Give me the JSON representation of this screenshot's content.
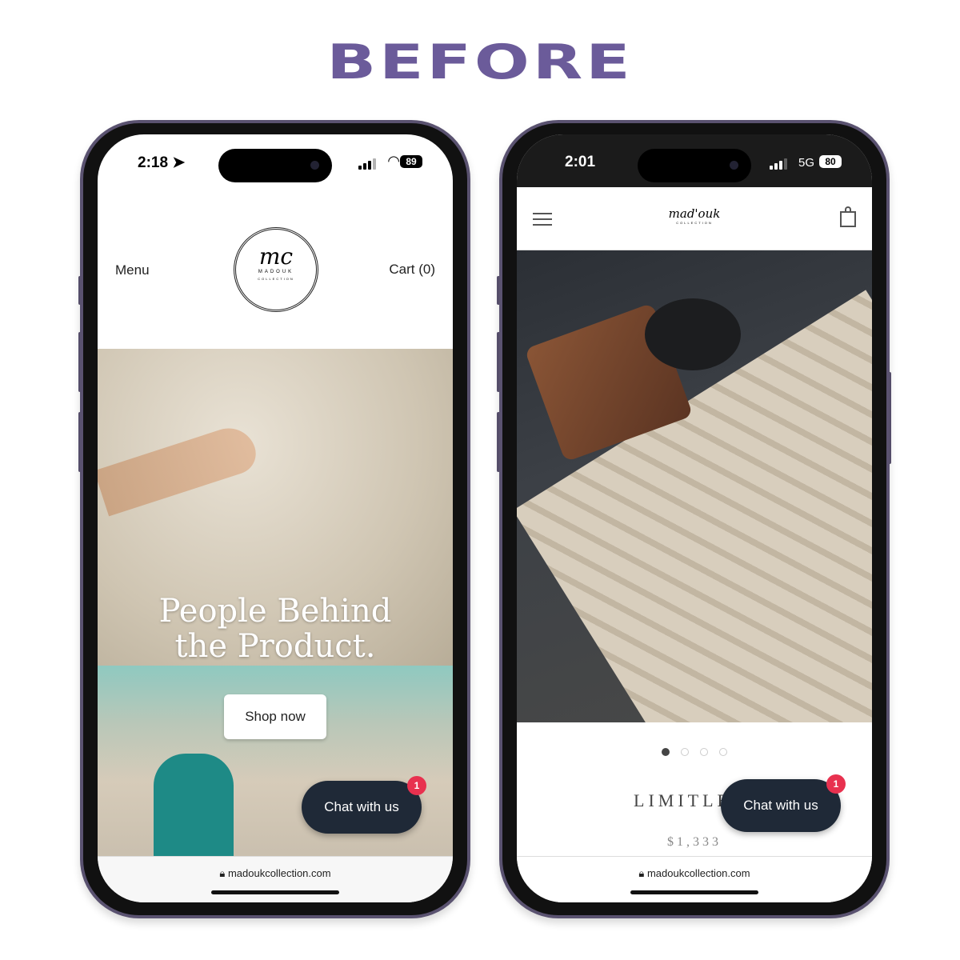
{
  "heading": "BEFORE",
  "colors": {
    "heading": "#6b5b9a",
    "chat_button": "#1f2937",
    "badge": "#e8314f"
  },
  "left_phone": {
    "status": {
      "time": "2:18",
      "battery": "89",
      "icons": [
        "location-arrow-icon",
        "signal-icon",
        "wifi-icon",
        "battery-icon"
      ]
    },
    "nav": {
      "menu": "Menu",
      "cart": "Cart (0)",
      "logo_text": "MADOUK",
      "logo_sub": "COLLECTION",
      "logo_mark": "mc"
    },
    "hero": {
      "headline_line1": "People Behind",
      "headline_line2": "the Product.",
      "cta": "Shop now"
    },
    "chat": {
      "label": "Chat with us",
      "badge": "1"
    },
    "url": "madoukcollection.com"
  },
  "right_phone": {
    "status": {
      "time": "2:01",
      "network": "5G",
      "battery": "80"
    },
    "nav": {
      "logo_text": "mad'ouk",
      "logo_sub": "COLLECTION",
      "icons": [
        "hamburger-menu-icon",
        "shopping-bag-icon"
      ]
    },
    "carousel": {
      "slides": 4,
      "active": 1
    },
    "product": {
      "title": "LIMITLE",
      "price": "$1,333"
    },
    "chat": {
      "label": "Chat with us",
      "badge": "1"
    },
    "url": "madoukcollection.com"
  }
}
